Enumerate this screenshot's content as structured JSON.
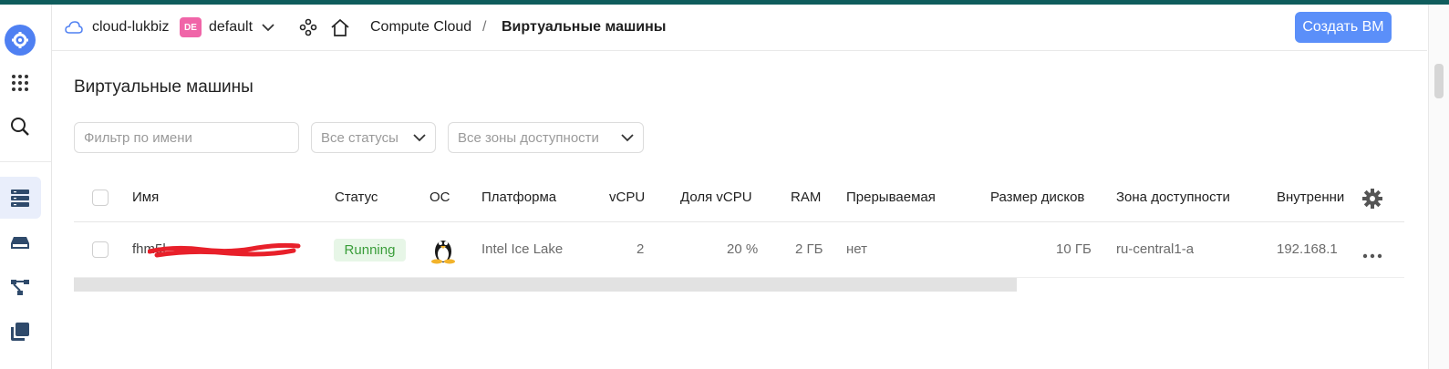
{
  "colors": {
    "accent": "#5b8ff9",
    "topbar": "#0f5c5c",
    "badge_de": "#f065a8",
    "running_bg": "#e7f6e7",
    "running_fg": "#3a9d3a"
  },
  "rail": {
    "items": [
      "logo-icon",
      "apps-grid-icon",
      "search-icon",
      "server-icon",
      "disk-icon",
      "network-icon",
      "copy-icon"
    ]
  },
  "header": {
    "cloud_name": "cloud-lukbiz",
    "folder_badge": "DE",
    "folder_name": "default",
    "breadcrumb_service": "Compute Cloud",
    "breadcrumb_separator": "/",
    "breadcrumb_current": "Виртуальные машины",
    "create_button": "Создать ВМ"
  },
  "page": {
    "title": "Виртуальные машины",
    "filter_placeholder": "Фильтр по имени",
    "status_select": "Все статусы",
    "zone_select": "Все зоны доступности"
  },
  "table": {
    "columns": [
      "Имя",
      "Статус",
      "ОС",
      "Платформа",
      "vCPU",
      "Доля vCPU",
      "RAM",
      "Прерываемая",
      "Размер дисков",
      "Зона доступности",
      "Внутренни"
    ],
    "rows": [
      {
        "name": "fhm5l...",
        "status": "Running",
        "os": "linux-tux-icon",
        "platform": "Intel Ice Lake",
        "vcpu": "2",
        "vcpu_share": "20 %",
        "ram": "2 ГБ",
        "preemptible": "нет",
        "disk_size": "10 ГБ",
        "zone": "ru-central1-a",
        "internal_ip": "192.168.1"
      }
    ]
  }
}
